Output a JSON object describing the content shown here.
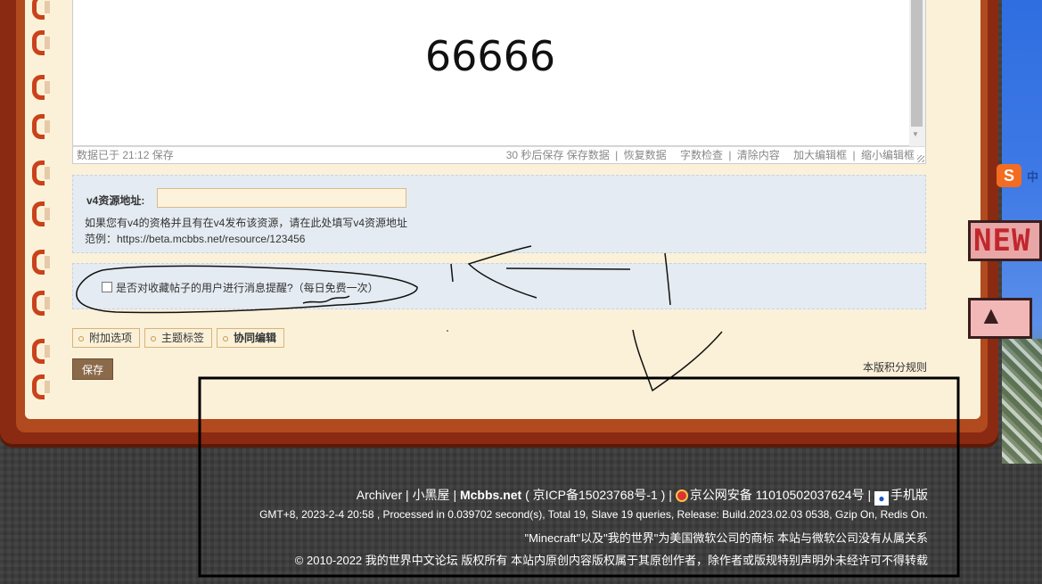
{
  "editor": {
    "content": "66666",
    "status_left": "数据已于 21:12 保存",
    "actions": [
      "30 秒后保存",
      "保存数据",
      "恢复数据",
      "字数检查",
      "清除内容",
      "加大编辑框",
      "缩小编辑框"
    ]
  },
  "v4": {
    "label": "v4资源地址:",
    "input_value": "",
    "hint1": "如果您有v4的资格并且有在v4发布该资源，请在此处填写v4资源地址",
    "hint2": "范例：https://beta.mcbbs.net/resource/123456"
  },
  "notify": {
    "label": "是否对收藏帖子的用户进行消息提醒?（每日免费一次）",
    "checked": false
  },
  "options": {
    "extra": "附加选项",
    "tags": "主题标签",
    "collab": "协同编辑"
  },
  "save_label": "保存",
  "rules_link": "本版积分规则",
  "footer": {
    "archiver": "Archiver",
    "sep": "|",
    "xiaoheiwu": "小黑屋",
    "site": "Mcbbs.net",
    "icp": "( 京ICP备15023768号-1 )",
    "police": "京公网安备 11010502037624号",
    "mobile": "手机版",
    "stats": "GMT+8, 2023-2-4 20:58 , Processed in 0.039702 second(s), Total 19, Slave 19 queries, Release: Build.2023.02.03 0538, Gzip On, Redis On.",
    "trademark": "\"Minecraft\"以及\"我的世界\"为美国微软公司的商标 本站与微软公司没有从属关系",
    "copyright": "© 2010-2022 我的世界中文论坛 版权所有 本站内原创内容版权属于其原创作者，除作者或版规特别声明外未经许可不得转载"
  },
  "stickers": {
    "s": "S",
    "s_text": "中",
    "new": "NEW",
    "up": "▲"
  },
  "colors": {
    "frame": "#8a2a12",
    "page": "#fbf1d8",
    "box": "#e5ebf2",
    "save": "#8b6a4a"
  }
}
